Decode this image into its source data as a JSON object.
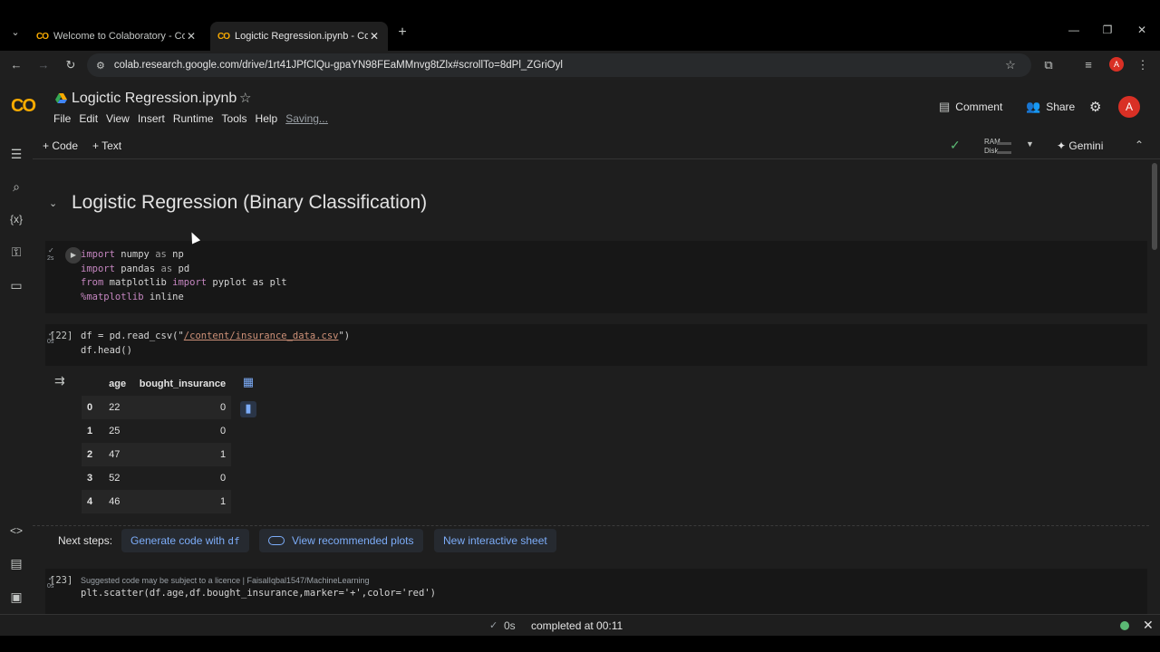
{
  "browser": {
    "tabs": [
      {
        "favicon": "CO",
        "title": "Welcome to Colaboratory - Col",
        "close": "✕"
      },
      {
        "favicon": "CO",
        "title": "Logictic Regression.ipynb - Col",
        "close": "✕"
      }
    ],
    "new_tab": "+",
    "url": "colab.research.google.com/drive/1rt41JPfClQu-gpaYN98FEaMMnvg8tZlx#scrollTo=8dPl_ZGriOyl",
    "profile_initial": "A"
  },
  "colab": {
    "logo": "CO",
    "notebook_title": "Logictic Regression.ipynb",
    "menu": [
      "File",
      "Edit",
      "View",
      "Insert",
      "Runtime",
      "Tools",
      "Help"
    ],
    "saving_status": "Saving...",
    "comment_label": "Comment",
    "share_label": "Share",
    "avatar_initial": "A"
  },
  "cell_toolbar": {
    "add_code": "+ Code",
    "add_text": "+ Text",
    "ram_label": "RAM",
    "disk_label": "Disk",
    "gemini_label": "Gemini"
  },
  "notebook": {
    "section_title": "Logistic Regression (Binary Classification)",
    "cell1": {
      "exec_time": "2s",
      "lines": [
        {
          "kw": "import",
          "rest": " numpy ",
          "kw2": "as",
          "tail": " np"
        },
        {
          "kw": "import",
          "rest": " pandas ",
          "kw2": "as",
          "tail": " pd"
        },
        {
          "kw": "from",
          "rest": " matplotlib ",
          "kw2": "import",
          "tail": " pyplot as plt"
        },
        {
          "kw": "%matplotlib",
          "rest": " inline",
          "kw2": "",
          "tail": ""
        }
      ]
    },
    "cell2": {
      "exec_count": "[22]",
      "exec_time": "0s",
      "line1_pre": "df = pd.read_csv(\"",
      "line1_str": "/content/insurance_data.csv",
      "line1_post": "\")",
      "line2": "df.head()"
    },
    "dataframe": {
      "columns": [
        "age",
        "bought_insurance"
      ],
      "rows": [
        {
          "idx": "0",
          "age": "22",
          "bought_insurance": "0"
        },
        {
          "idx": "1",
          "age": "25",
          "bought_insurance": "0"
        },
        {
          "idx": "2",
          "age": "47",
          "bought_insurance": "1"
        },
        {
          "idx": "3",
          "age": "52",
          "bought_insurance": "0"
        },
        {
          "idx": "4",
          "age": "46",
          "bought_insurance": "1"
        }
      ]
    },
    "next_steps": {
      "label": "Next steps:",
      "generate": "Generate code with",
      "generate_var": "df",
      "recommended": "View recommended plots",
      "interactive": "New interactive sheet"
    },
    "cell3": {
      "exec_count": "[23]",
      "exec_time": "0s",
      "suggestion": "Suggested code may be subject to a licence | FaisalIqbal1547/MachineLearning",
      "code": "plt.scatter(df.age,df.bought_insurance,marker='+',color='red')"
    }
  },
  "status": {
    "check": "✓",
    "time": "0s",
    "text": "completed at 00:11"
  }
}
